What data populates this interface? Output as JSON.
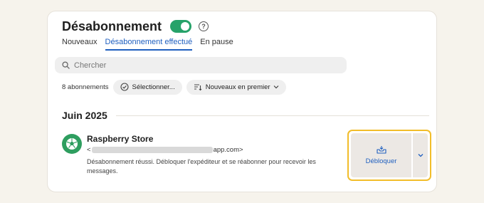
{
  "header": {
    "title": "Désabonnement",
    "toggle_on": true
  },
  "tabs": [
    {
      "label": "Nouveaux",
      "active": false
    },
    {
      "label": "Désabonnement effectué",
      "active": true
    },
    {
      "label": "En pause",
      "active": false
    }
  ],
  "search": {
    "placeholder": "Chercher"
  },
  "filters": {
    "count": "8 abonnements",
    "select_label": "Sélectionner...",
    "sort_label": "Nouveaux en premier"
  },
  "section": {
    "title": "Juin 2025"
  },
  "item": {
    "name": "Raspberry Store",
    "email_prefix": "<",
    "email_suffix": "app.com>",
    "message": "Désabonnement réussi. Débloquer l'expéditeur et se réabonner pour recevoir les messages."
  },
  "actions": {
    "unblock_label": "Débloquer"
  },
  "colors": {
    "accent": "#1f5fbf",
    "toggle": "#26a269",
    "highlight": "#f2bd2a",
    "avatar": "#2e9e5f"
  },
  "icons": [
    "help-icon",
    "search-icon",
    "check-circle-icon",
    "sort-icon",
    "chevron-down-icon",
    "inbox-icon",
    "soccer-ball-icon"
  ]
}
